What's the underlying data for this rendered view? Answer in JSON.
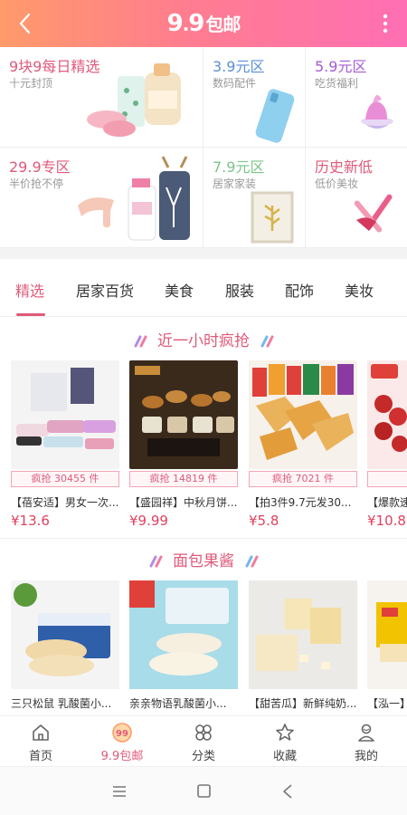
{
  "header": {
    "logo_main": "9",
    "logo_dot": ".",
    "logo_second": "9",
    "logo_word": "包邮"
  },
  "categories": [
    {
      "title": "9块9每日精选",
      "subtitle": "十元封顶",
      "title_color": "#e05a7a"
    },
    {
      "title": "3.9元区",
      "subtitle": "数码配件",
      "title_color": "#5b8fd6"
    },
    {
      "title": "5.9元区",
      "subtitle": "吃货福利",
      "title_color": "#a45bd6"
    },
    {
      "title": "29.9专区",
      "subtitle": "半价抢不停",
      "title_color": "#e05a7a"
    },
    {
      "title": "7.9元区",
      "subtitle": "居家家装",
      "title_color": "#7cc48a"
    },
    {
      "title": "历史新低",
      "subtitle": "低价美妆",
      "title_color": "#e05a7a"
    }
  ],
  "tabs": [
    "精选",
    "居家百货",
    "美食",
    "服装",
    "配饰",
    "美妆"
  ],
  "active_tab": 0,
  "section1": {
    "title": "近一小时疯抢",
    "items": [
      {
        "badge": "疯抢 30455 件",
        "name": "【蓓安适】男女一次...",
        "price": "¥13.6"
      },
      {
        "badge": "疯抢 14819 件",
        "name": "【盛园祥】中秋月饼...",
        "price": "¥9.99"
      },
      {
        "badge": "疯抢 7021 件",
        "name": "【拍3件9.7元发30...",
        "price": "¥5.8"
      },
      {
        "badge": "疯",
        "name": "【爆款速",
        "price": "¥10.8"
      }
    ]
  },
  "section2": {
    "title": "面包果酱",
    "items": [
      {
        "name": "三只松鼠 乳酸菌小..."
      },
      {
        "name": "亲亲物语乳酸菌小..."
      },
      {
        "name": "【甜苦瓜】新鲜纯奶..."
      },
      {
        "name": "【泓一】"
      }
    ]
  },
  "bottom_nav": [
    {
      "label": "首页",
      "icon": "home-icon"
    },
    {
      "label": "9.9包邮",
      "icon": "nine-nine-icon"
    },
    {
      "label": "分类",
      "icon": "category-icon"
    },
    {
      "label": "收藏",
      "icon": "star-icon"
    },
    {
      "label": "我的",
      "icon": "profile-icon"
    }
  ],
  "active_nav": 1,
  "colors": {
    "accent": "#e05a7a",
    "price": "#e0425f",
    "header_gradient_start": "#ff9a6a",
    "header_gradient_end": "#ff6fb4"
  }
}
